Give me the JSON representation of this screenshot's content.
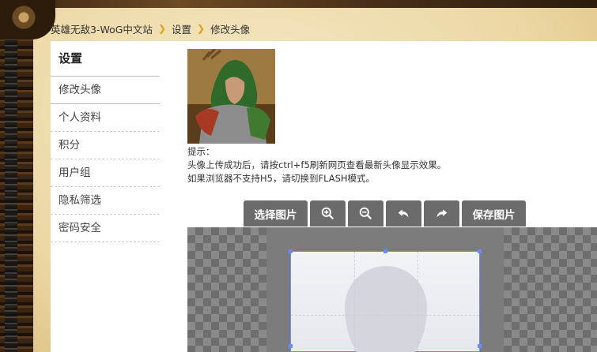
{
  "breadcrumb": {
    "site": "英雄无敌3-WoG中文站",
    "section": "设置",
    "page": "修改头像"
  },
  "sidebar": {
    "title": "设置",
    "items": [
      {
        "label": "修改头像",
        "active": true
      },
      {
        "label": "个人资料"
      },
      {
        "label": "积分"
      },
      {
        "label": "用户组"
      },
      {
        "label": "隐私筛选"
      },
      {
        "label": "密码安全"
      }
    ]
  },
  "hint": {
    "label": "提示：",
    "line1": "头像上传成功后，请按ctrl+f5刷新网页查看最新头像显示效果。",
    "line2": "如果浏览器不支持H5，请切换到FLASH模式。"
  },
  "toolbar": {
    "select_image": "选择图片",
    "zoom_in_icon": "zoom-in-icon",
    "zoom_out_icon": "zoom-out-icon",
    "rotate_left_icon": "rotate-left-icon",
    "rotate_right_icon": "rotate-right-icon",
    "save_image": "保存图片"
  },
  "colors": {
    "accent_chevron": "#e0a010",
    "toolbar_bg": "#6b6b6b",
    "crop_border": "#6b8cff"
  }
}
